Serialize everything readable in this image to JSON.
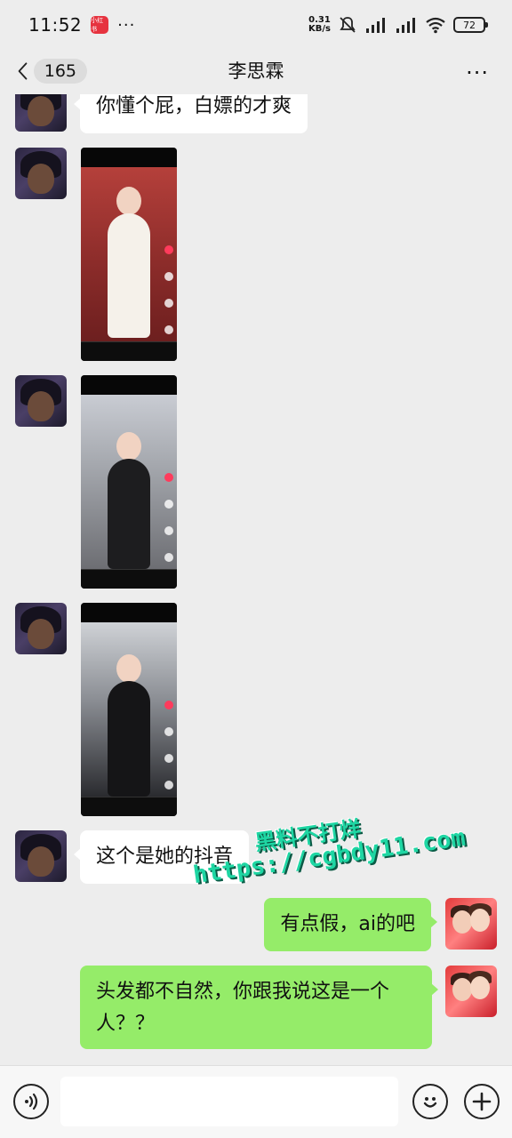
{
  "status_bar": {
    "time": "11:52",
    "app_badge": "小红书",
    "dots": "···",
    "net_speed_value": "0.31",
    "net_speed_unit": "KB/s",
    "battery": "72"
  },
  "header": {
    "unread_count": "165",
    "title": "李思霖",
    "more": "···"
  },
  "messages": [
    {
      "side": "in",
      "type": "text",
      "text": "你懂个屁，白嫖的才爽"
    },
    {
      "side": "in",
      "type": "image",
      "description": "video-screenshot-1"
    },
    {
      "side": "in",
      "type": "image",
      "description": "video-screenshot-2"
    },
    {
      "side": "in",
      "type": "image",
      "description": "video-screenshot-3"
    },
    {
      "side": "in",
      "type": "text",
      "text": "这个是她的抖音"
    },
    {
      "side": "out",
      "type": "text",
      "text": "有点假，ai的吧"
    },
    {
      "side": "out",
      "type": "text",
      "text": "头发都不自然，你跟我说这是一个人？？"
    }
  ],
  "watermark": {
    "line1": "黑料不打烊",
    "line2": "https://cgbdy11.com"
  },
  "colors": {
    "background": "#ededed",
    "bubble_out": "#95ec69",
    "bubble_in": "#ffffff"
  }
}
